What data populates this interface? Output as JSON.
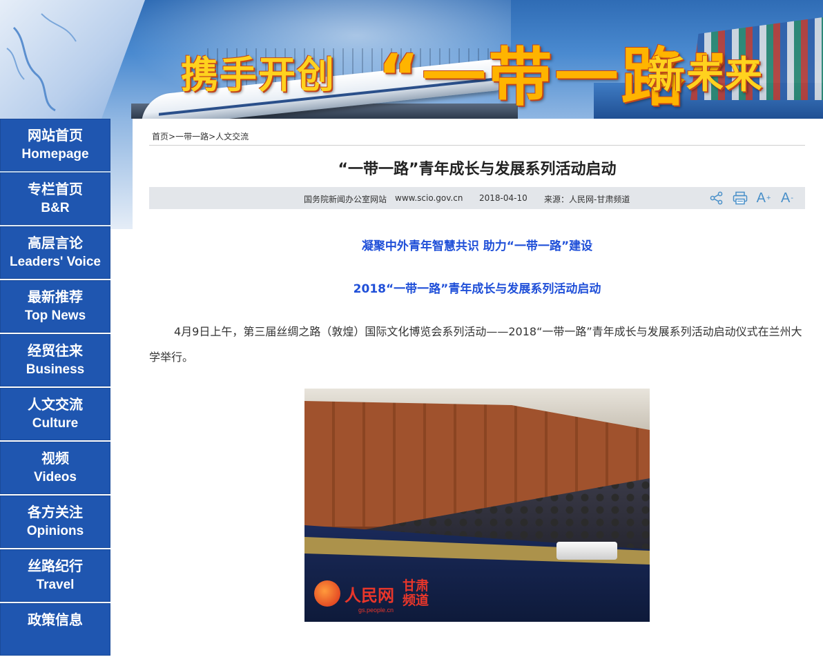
{
  "banner": {
    "slogan_part1": "携手开创",
    "slogan_part2": "“一带一路”",
    "slogan_part3": "新未来"
  },
  "sidebar": {
    "items": [
      {
        "cn": "网站首页",
        "en": "Homepage"
      },
      {
        "cn": "专栏首页",
        "en": "B&R"
      },
      {
        "cn": "高层言论",
        "en": "Leaders' Voice"
      },
      {
        "cn": "最新推荐",
        "en": "Top News"
      },
      {
        "cn": "经贸往来",
        "en": "Business"
      },
      {
        "cn": "人文交流",
        "en": "Culture"
      },
      {
        "cn": "视频",
        "en": "Videos"
      },
      {
        "cn": "各方关注",
        "en": "Opinions"
      },
      {
        "cn": "丝路纪行",
        "en": "Travel"
      },
      {
        "cn": "政策信息",
        "en": ""
      }
    ]
  },
  "breadcrumb": {
    "home": "首页",
    "sep": ">",
    "section": "一带一路",
    "current": "人文交流"
  },
  "article": {
    "title": "“一带一路”青年成长与发展系列活动启动",
    "meta": {
      "publisher": "国务院新闻办公室网站",
      "site": "www.scio.gov.cn",
      "date": "2018-04-10",
      "source": "来源：人民网-甘肃频道"
    },
    "tools": {
      "font_plus": "A",
      "font_minus": "A",
      "plus_sign": "+",
      "minus_sign": "-"
    },
    "subhead1": "凝聚中外青年智慧共识 助力“一带一路”建设",
    "subhead2": "2018“一带一路”青年成长与发展系列活动启动",
    "paragraph": "4月9日上午，第三届丝绸之路（敦煌）国际文化博览会系列活动——2018“一带一路”青年成长与发展系列活动启动仪式在兰州大学举行。",
    "photo_watermark": {
      "logo_text": "人民网",
      "domain": "gs.people.cn",
      "channel_line1": "甘肃",
      "channel_line2": "频道"
    }
  }
}
